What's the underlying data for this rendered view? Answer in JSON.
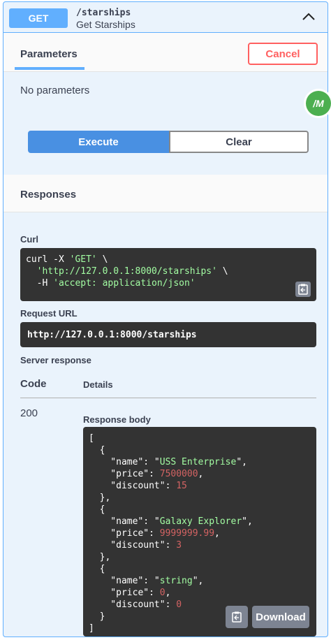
{
  "operation": {
    "method": "GET",
    "path": "/starships",
    "summary": "Get Starships"
  },
  "parameters": {
    "tab_label": "Parameters",
    "cancel_label": "Cancel",
    "empty_text": "No parameters"
  },
  "badge": {
    "text": "/M",
    "color": "#4caf50"
  },
  "actions": {
    "execute_label": "Execute",
    "clear_label": "Clear"
  },
  "responses": {
    "title": "Responses",
    "curl_label": "Curl",
    "curl_line1_cmd": "curl -X ",
    "curl_line1_str": "'GET'",
    "curl_line1_tail": " \\",
    "curl_line2_str": "'http://127.0.0.1:8000/starships'",
    "curl_line2_tail": " \\",
    "curl_line3_cmd": "  -H ",
    "curl_line3_str": "'accept: application/json'",
    "request_url_label": "Request URL",
    "request_url": "http://127.0.0.1:8000/starships",
    "server_response_label": "Server response",
    "col_code": "Code",
    "col_details": "Details",
    "status_code": "200",
    "response_body_label": "Response body",
    "download_label": "Download"
  },
  "response_body": [
    {
      "name": "USS Enterprise",
      "price": "7500000",
      "discount": "15"
    },
    {
      "name": "Galaxy Explorer",
      "price": "9999999.99",
      "discount": "3"
    },
    {
      "name": "string",
      "price": "0",
      "discount": "0"
    }
  ],
  "colors": {
    "get": "#61affe",
    "cancel": "#ff6060",
    "execute": "#4990e2",
    "string": "#a2fca2",
    "number": "#d36363"
  }
}
